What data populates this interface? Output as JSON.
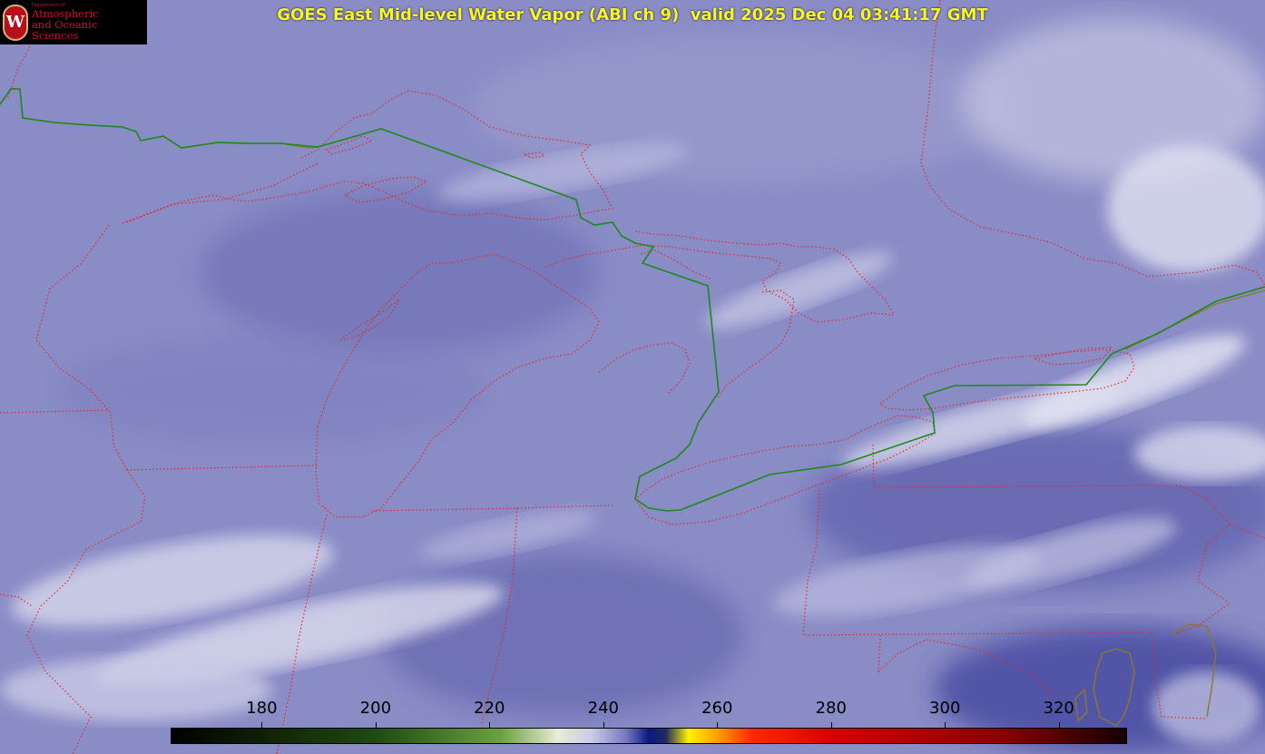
{
  "title": "GOES East Mid-level Water Vapor (ABI ch 9)  valid 2025 Dec 04 03:41:17 GMT",
  "logo": {
    "department": "Department of",
    "line1": "Atmospheric",
    "line2": "and Oceanic Sciences",
    "seal_letter": "W"
  },
  "colorbar": {
    "ticks": [
      "180",
      "200",
      "220",
      "240",
      "260",
      "280",
      "300",
      "320"
    ],
    "range": [
      164,
      332
    ],
    "stops": [
      {
        "value": 164,
        "color": "#000000"
      },
      {
        "value": 200,
        "color": "#1f4a12"
      },
      {
        "value": 222,
        "color": "#6aa23f"
      },
      {
        "value": 232,
        "color": "#e8ecd8"
      },
      {
        "value": 238,
        "color": "#c9cae6"
      },
      {
        "value": 244,
        "color": "#7478c0"
      },
      {
        "value": 248,
        "color": "#0a1a80"
      },
      {
        "value": 251,
        "color": "#1e2a60"
      },
      {
        "value": 255,
        "color": "#fff200"
      },
      {
        "value": 260,
        "color": "#ffa000"
      },
      {
        "value": 266,
        "color": "#ff2a00"
      },
      {
        "value": 280,
        "color": "#d80000"
      },
      {
        "value": 310,
        "color": "#8a0000"
      },
      {
        "value": 332,
        "color": "#140000"
      }
    ]
  },
  "colors": {
    "boundary": "#e8262a",
    "coast": "#1c8a1c",
    "coast_outline": "#8a7a2a"
  }
}
